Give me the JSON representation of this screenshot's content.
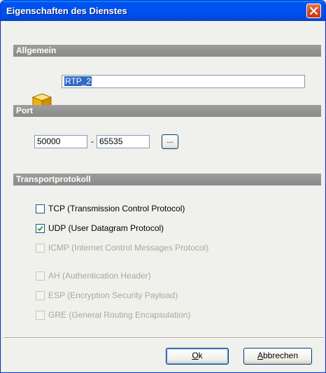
{
  "window": {
    "title": "Eigenschaften des Dienstes"
  },
  "sections": {
    "general": "Allgemein",
    "port": "Port",
    "transport": "Transportprotokoll"
  },
  "general": {
    "icon": "service-cube-icon",
    "name_value": "RTP_2"
  },
  "port": {
    "from": "50000",
    "separator": "-",
    "to": "65535",
    "browse_label": "..."
  },
  "protocols": [
    {
      "label": "TCP (Transmission Control Protocol)",
      "checked": false,
      "enabled": true
    },
    {
      "label": "UDP (User Datagram Protocol)",
      "checked": true,
      "enabled": true
    },
    {
      "label": "ICMP (Internet Control Messages Protocol)",
      "checked": false,
      "enabled": false
    },
    {
      "label": "AH (Authentication Header)",
      "checked": false,
      "enabled": false
    },
    {
      "label": "ESP (Encryption Security Payload)",
      "checked": false,
      "enabled": false
    },
    {
      "label": "GRE (General Routing Encapsulation)",
      "checked": false,
      "enabled": false
    }
  ],
  "buttons": {
    "ok_mnemonic": "O",
    "ok_rest": "k",
    "cancel_mnemonic": "A",
    "cancel_rest": "bbrechen"
  },
  "colors": {
    "titlebar": "#0054e3",
    "section_header": "#8c8c8c",
    "selection": "#316ac5",
    "close_button": "#d84b22"
  }
}
